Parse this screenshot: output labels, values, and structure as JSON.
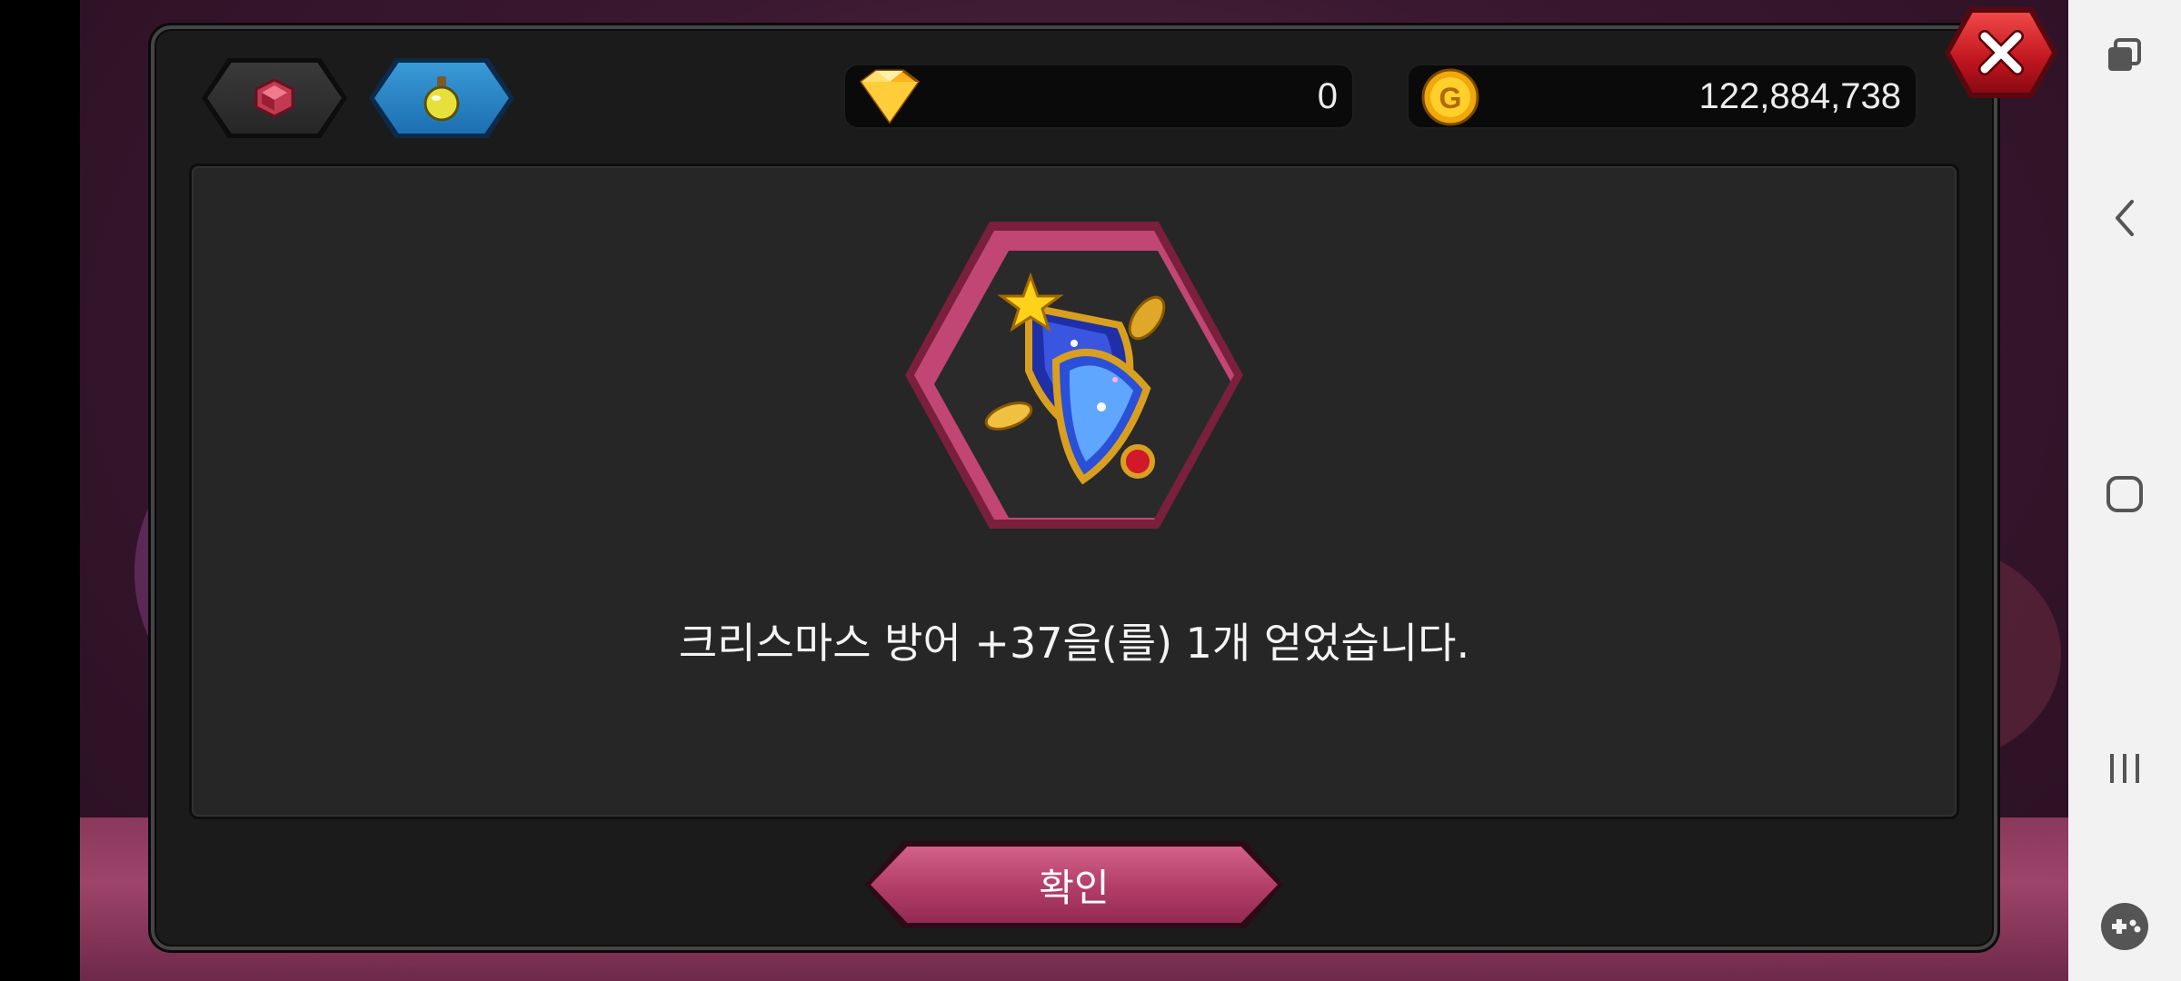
{
  "header": {
    "tabs": [
      {
        "icon": "ruby-gem-icon",
        "active": false
      },
      {
        "icon": "potion-flask-icon",
        "active": true
      }
    ],
    "diamond_icon": "diamond-icon",
    "diamond_amount": "0",
    "gold_icon": "gold-coin-icon",
    "gold_amount": "122,884,738"
  },
  "dialog": {
    "item_icon": "christmas-defense-gem-icon",
    "message": "크리스마스 방어 +37을(를) 1개 얻었습니다.",
    "confirm_label": "확인"
  },
  "nav_bar": {
    "icons": [
      "recent-apps-window-icon",
      "back-chevron-icon",
      "home-square-icon",
      "recents-lines-icon",
      "gamepad-icon"
    ]
  },
  "colors": {
    "confirm_button": "#b23d67",
    "close_button": "#c0151f",
    "item_frame": "#c24674",
    "panel": "#262626"
  }
}
